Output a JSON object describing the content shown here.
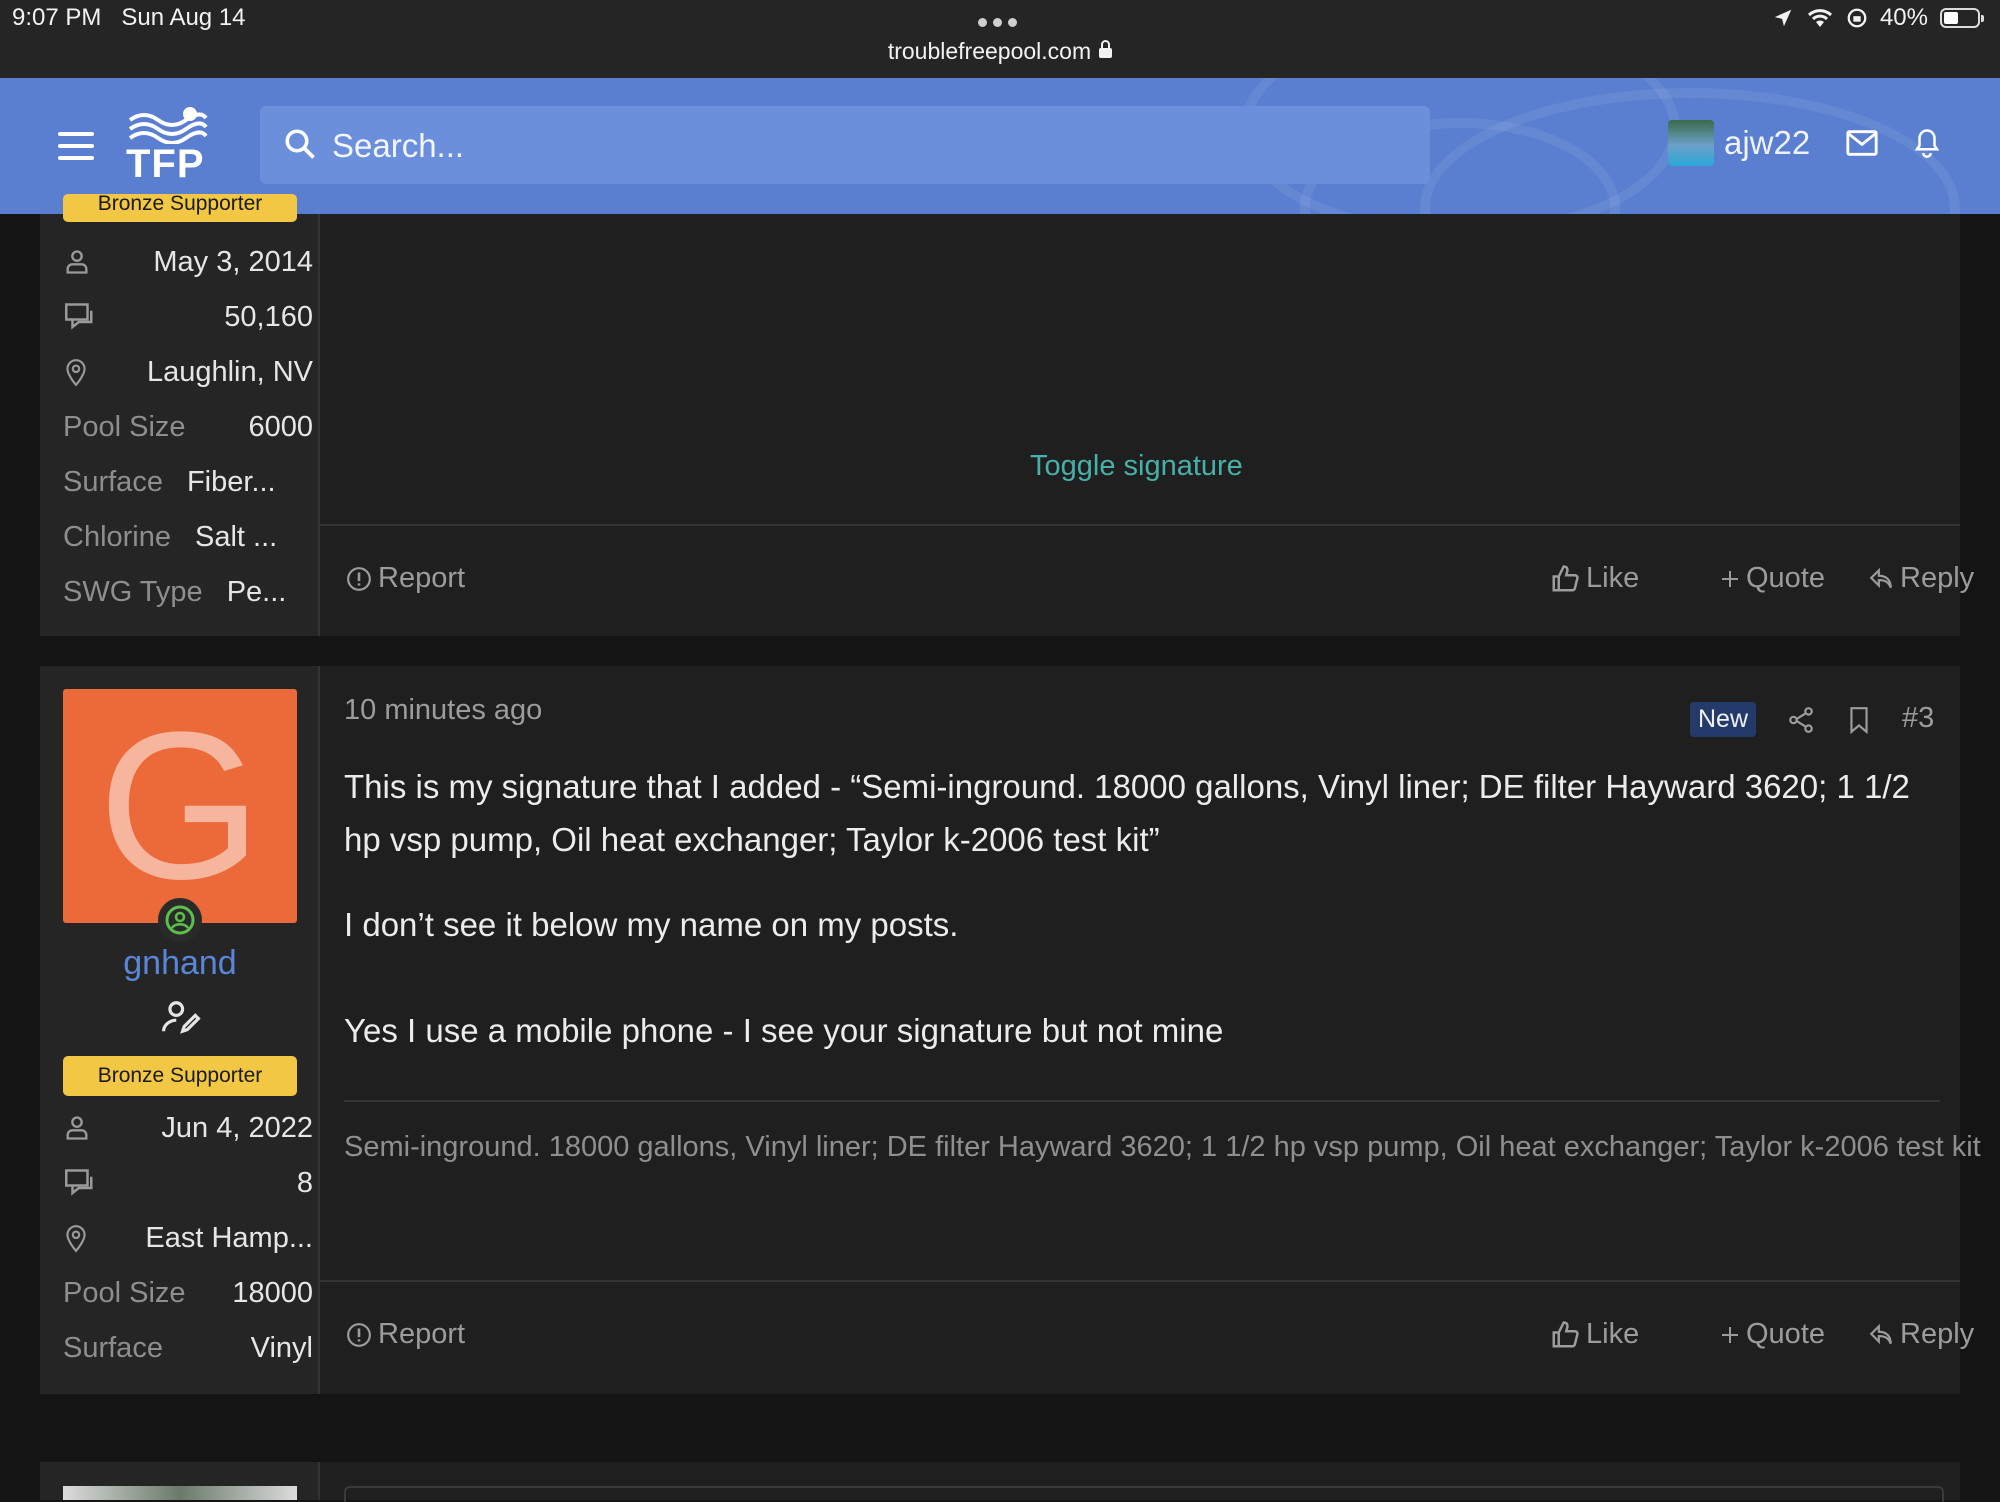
{
  "status_bar": {
    "time": "9:07 PM",
    "date": "Sun Aug 14",
    "url": "troublefreepool.com",
    "battery": "40%"
  },
  "header": {
    "logo_text": "TFP",
    "search_placeholder": "Search...",
    "username": "ajw22"
  },
  "post1": {
    "badge": "Bronze Supporter",
    "joined": "May 3, 2014",
    "messages": "50,160",
    "location": "Laughlin, NV",
    "fields": [
      {
        "label": "Pool Size",
        "value": "6000"
      },
      {
        "label": "Surface",
        "value": "Fiber..."
      },
      {
        "label": "Chlorine",
        "value": "Salt ..."
      },
      {
        "label": "SWG Type",
        "value": "Pe..."
      }
    ],
    "toggle_signature": "Toggle signature",
    "actions": {
      "report": "Report",
      "like": "Like",
      "quote": "Quote",
      "reply": "Reply"
    }
  },
  "post2": {
    "avatar_letter": "G",
    "username": "gnhand",
    "badge": "Bronze Supporter",
    "joined": "Jun 4, 2022",
    "messages": "8",
    "location": "East Hamp...",
    "fields": [
      {
        "label": "Pool Size",
        "value": "18000"
      },
      {
        "label": "Surface",
        "value": "Vinyl"
      }
    ],
    "time": "10 minutes ago",
    "new_label": "New",
    "post_number": "#3",
    "body": [
      "This is my signature that I added - “Semi-inground. 18000 gallons, Vinyl liner; DE filter Hayward 3620; 1 1/2 hp vsp pump, Oil heat exchanger; Taylor k-2006 test kit”",
      "I don’t see it below my name on my posts.",
      "Yes I use a mobile phone - I see your signature but not mine"
    ],
    "signature": "Semi-inground. 18000 gallons, Vinyl liner; DE filter Hayward 3620; 1 1/2 hp vsp pump, Oil heat exchanger; Taylor k-2006 test kit",
    "actions": {
      "report": "Report",
      "like": "Like",
      "quote": "Quote",
      "reply": "Reply"
    }
  }
}
